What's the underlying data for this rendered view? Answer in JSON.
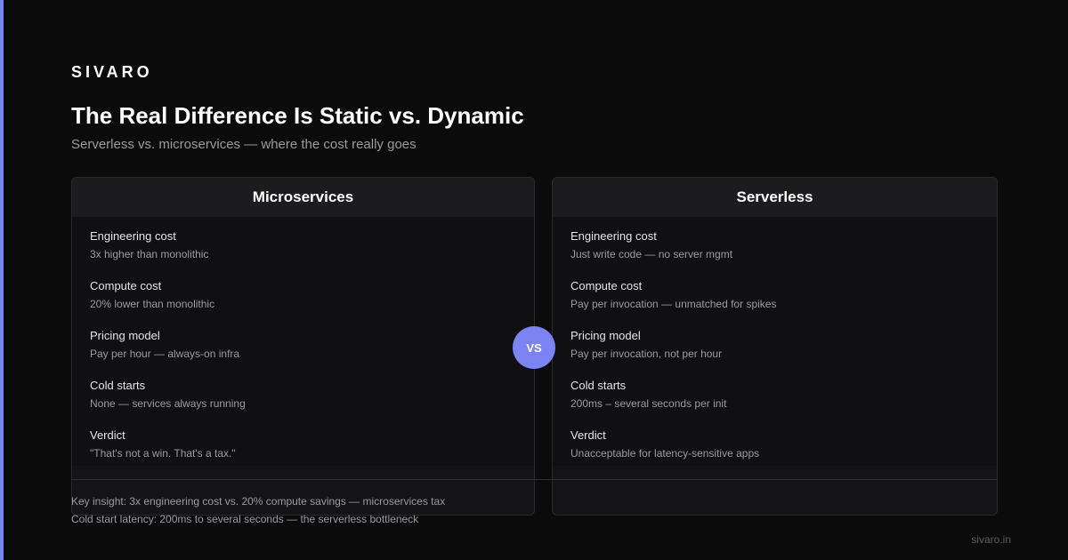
{
  "brand": "SIVARO",
  "title": "The Real Difference Is Static vs. Dynamic",
  "subtitle": "Serverless vs. microservices — where the cost really goes",
  "vs_label": "VS",
  "left": {
    "heading": "Microservices",
    "rows": [
      {
        "label": "Engineering cost",
        "value": "3x higher than monolithic"
      },
      {
        "label": "Compute cost",
        "value": "20% lower than monolithic"
      },
      {
        "label": "Pricing model",
        "value": "Pay per hour — always-on infra"
      },
      {
        "label": "Cold starts",
        "value": "None — services always running"
      },
      {
        "label": "Verdict",
        "value": "\"That's not a win. That's a tax.\""
      }
    ]
  },
  "right": {
    "heading": "Serverless",
    "rows": [
      {
        "label": "Engineering cost",
        "value": "Just write code — no server mgmt"
      },
      {
        "label": "Compute cost",
        "value": "Pay per invocation — unmatched for spikes"
      },
      {
        "label": "Pricing model",
        "value": "Pay per invocation, not per hour"
      },
      {
        "label": "Cold starts",
        "value": "200ms – several seconds per init"
      },
      {
        "label": "Verdict",
        "value": "Unacceptable for latency-sensitive apps"
      }
    ]
  },
  "insights": [
    "Key insight: 3x engineering cost vs. 20% compute savings — microservices tax",
    "Cold start latency: 200ms to several seconds — the serverless bottleneck"
  ],
  "footer_url": "sivaro.in",
  "colors": {
    "accent": "#7c83f2",
    "background": "#0b0b0c"
  }
}
